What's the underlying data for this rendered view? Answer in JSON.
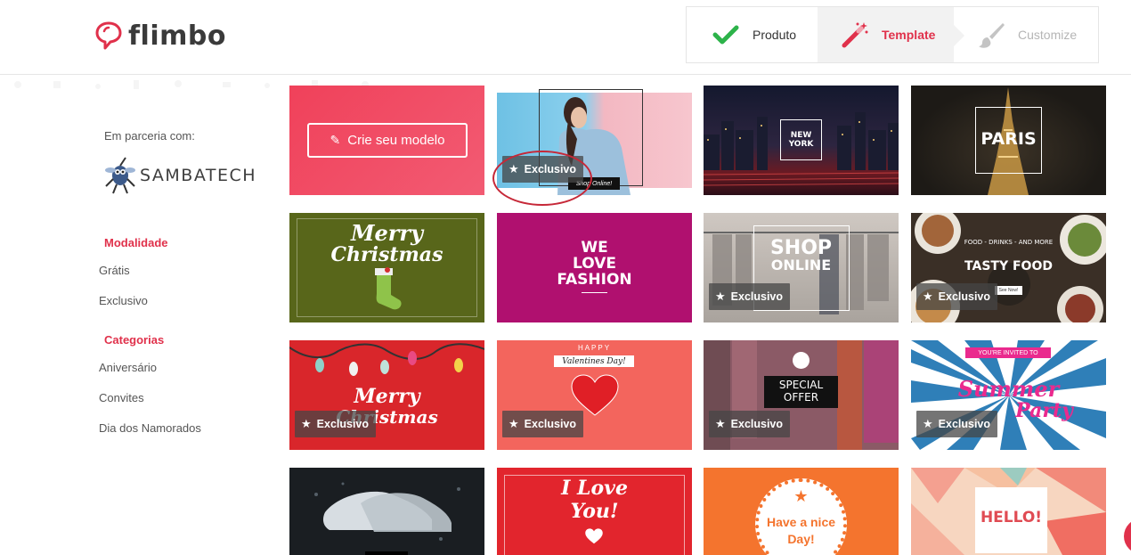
{
  "brand": {
    "name": "flimbo"
  },
  "steps": [
    {
      "label": "Produto",
      "icon": "check-icon",
      "state": "done"
    },
    {
      "label": "Template",
      "icon": "magic-wand-icon",
      "state": "active"
    },
    {
      "label": "Customize",
      "icon": "paintbrush-icon",
      "state": "pending"
    }
  ],
  "sidebar": {
    "partner_label": "Em parceria com:",
    "partner_name": "SAMBATECH",
    "modalidade": {
      "title": "Modalidade",
      "items": [
        "Grátis",
        "Exclusivo"
      ]
    },
    "categorias": {
      "title": "Categorias",
      "items": [
        "Aniversário",
        "Convites",
        "Dia dos Namorados"
      ]
    }
  },
  "badge_label": "Exclusivo",
  "templates": {
    "create": {
      "label": "Crie seu modelo"
    },
    "woman": {
      "caption": "Shop Online!",
      "exclusive": true
    },
    "new_york": {
      "line1": "NEW",
      "line2": "YORK",
      "exclusive": false
    },
    "paris": {
      "title": "PARIS",
      "exclusive": false
    },
    "merry_christmas_green": {
      "line1": "Merry",
      "line2": "Christmas",
      "exclusive": false
    },
    "we_love_fashion": {
      "line1": "WE",
      "line2": "LOVE",
      "line3": "FASHION",
      "exclusive": false
    },
    "shop_online": {
      "line1": "SHOP",
      "line2": "ONLINE",
      "exclusive": true
    },
    "tasty_food": {
      "kicker": "FOOD - DRINKS - AND MORE",
      "title": "TASTY FOOD",
      "button": "See Now!",
      "exclusive": true
    },
    "merry_christmas_red": {
      "line1": "Merry",
      "line2": "Christmas",
      "exclusive": true
    },
    "valentines": {
      "kicker": "HAPPY",
      "title": "Valentines Day!",
      "exclusive": true
    },
    "special_offer": {
      "line1": "SPECIAL",
      "line2": "OFFER",
      "exclusive": true
    },
    "summer_party": {
      "kicker": "YOU'RE INVITED TO",
      "line1": "Summer",
      "line2": "Party",
      "exclusive": true
    },
    "sneakers": {
      "exclusive": false
    },
    "i_love_you": {
      "line1": "I Love",
      "line2": "You!",
      "exclusive": false
    },
    "have_a_nice_day": {
      "line1": "Have a nice",
      "line2": "Day!",
      "exclusive": false
    },
    "hello": {
      "title": "HELLO!",
      "exclusive": false
    }
  },
  "colors": {
    "brand_red": "#e0314b",
    "check_green": "#2db34a",
    "muted_gray": "#b5b5b5"
  }
}
